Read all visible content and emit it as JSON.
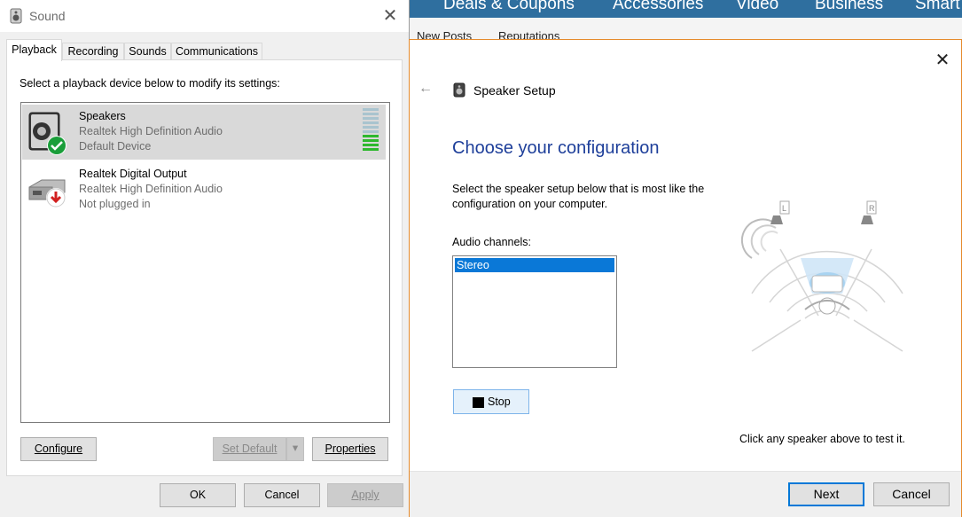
{
  "background_site": {
    "nav_items": [
      "Deals & Coupons",
      "Accessories",
      "Video",
      "Business",
      "Smart"
    ],
    "sub_items": [
      "New Posts",
      "Reputations"
    ]
  },
  "sound_window": {
    "title": "Sound",
    "tabs": [
      {
        "label": "Playback",
        "active": true
      },
      {
        "label": "Recording",
        "active": false
      },
      {
        "label": "Sounds",
        "active": false
      },
      {
        "label": "Communications",
        "active": false
      }
    ],
    "prompt": "Select a playback device below to modify its settings:",
    "devices": [
      {
        "name": "Speakers",
        "description": "Realtek High Definition Audio",
        "status": "Default Device",
        "selected": true,
        "level_bars_lit": 4,
        "level_bars_total": 10
      },
      {
        "name": "Realtek Digital Output",
        "description": "Realtek High Definition Audio",
        "status": "Not plugged in",
        "selected": false
      }
    ],
    "buttons": {
      "configure": "Configure",
      "set_default": "Set Default",
      "properties": "Properties",
      "ok": "OK",
      "cancel": "Cancel",
      "apply": "Apply"
    }
  },
  "speaker_setup": {
    "title": "Speaker Setup",
    "heading": "Choose your configuration",
    "description": "Select the speaker setup below that is most like the configuration on your computer.",
    "channels_label": "Audio channels:",
    "channels": [
      "Stereo"
    ],
    "selected_channel": "Stereo",
    "stop_label": "Stop",
    "hint": "Click any speaker above to test it.",
    "speaker_labels": {
      "left": "L",
      "right": "R"
    },
    "buttons": {
      "next": "Next",
      "cancel": "Cancel"
    }
  },
  "colors": {
    "heading_blue": "#1e3f9a",
    "selection_blue": "#0a78d7",
    "accent_border": "#e58a2c",
    "meter_green": "#2eb82e"
  }
}
